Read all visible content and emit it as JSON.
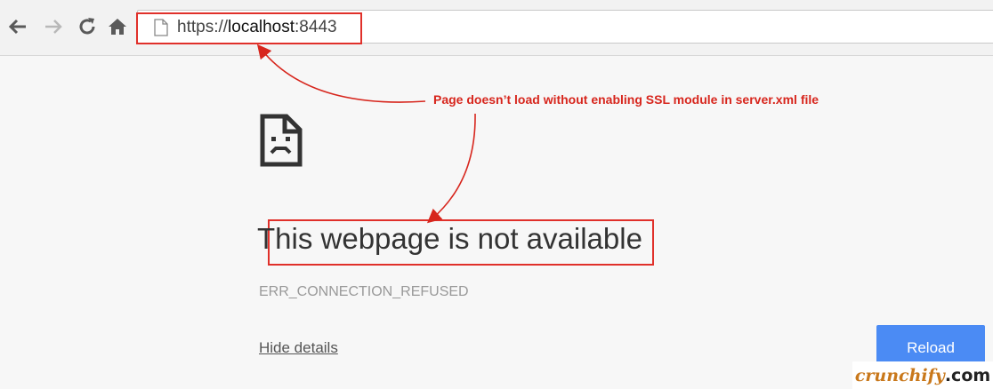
{
  "browser": {
    "url_scheme": "https://",
    "url_host": "localhost",
    "url_port": ":8443"
  },
  "annotation": {
    "text": "Page doesn’t load without enabling SSL module in server.xml file",
    "color": "#e0302a"
  },
  "error_page": {
    "icon": "sad-page-icon",
    "headline": "This webpage is not available",
    "error_code": "ERR_CONNECTION_REFUSED",
    "details_link": "Hide details",
    "reload_label": "Reload",
    "reload_color": "#4b8bf4"
  },
  "watermark": {
    "main": "crunchify",
    "tld": ".com"
  }
}
